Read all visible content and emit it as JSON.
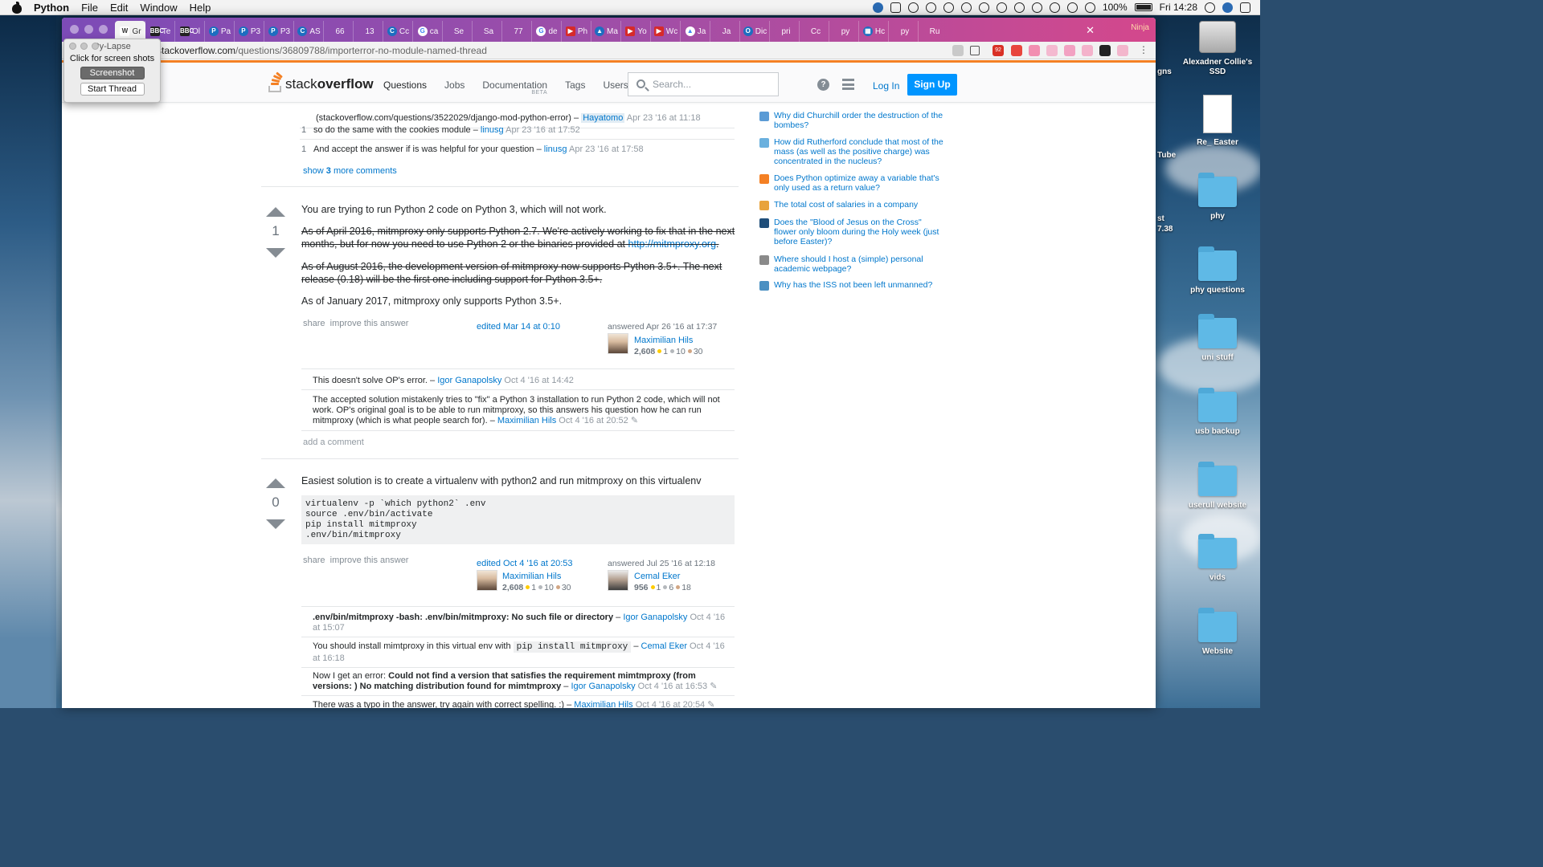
{
  "menubar": {
    "app": "Python",
    "items": [
      "File",
      "Edit",
      "Window",
      "Help"
    ],
    "battery": "100%",
    "clock": "Fri 14:28"
  },
  "desktop": {
    "icons": [
      {
        "label": "Alexadner Collie's SSD",
        "type": "disk"
      },
      {
        "label": "Re_ Easter",
        "type": "doc"
      },
      {
        "label": "phy",
        "type": "folder"
      },
      {
        "label": "phy questions",
        "type": "folder"
      },
      {
        "label": "uni stuff",
        "type": "folder"
      },
      {
        "label": "usb backup",
        "type": "folder"
      },
      {
        "label": "userull website",
        "type": "folder"
      },
      {
        "label": "vids",
        "type": "folder"
      },
      {
        "label": "Website",
        "type": "folder"
      }
    ],
    "fragments": [
      "gns",
      "Tube",
      "st",
      "7.38"
    ]
  },
  "tabs": [
    {
      "fav": "W",
      "label": "Gr",
      "style": ""
    },
    {
      "fav": "BBC",
      "label": "Te",
      "style": "k"
    },
    {
      "fav": "BBC",
      "label": "Ol",
      "style": "k"
    },
    {
      "fav": "P",
      "label": "Pa",
      "style": "b"
    },
    {
      "fav": "P",
      "label": "P3",
      "style": "b"
    },
    {
      "fav": "P",
      "label": "P3",
      "style": "b"
    },
    {
      "fav": "C",
      "label": "AS",
      "style": "b"
    },
    {
      "fav": "",
      "label": "66",
      "style": "none"
    },
    {
      "fav": "",
      "label": "13",
      "style": "none"
    },
    {
      "fav": "C",
      "label": "Cc",
      "style": "b"
    },
    {
      "fav": "G",
      "label": "ca",
      "style": "g"
    },
    {
      "fav": "",
      "label": "Se",
      "style": "none"
    },
    {
      "fav": "",
      "label": "Sa",
      "style": "none"
    },
    {
      "fav": "",
      "label": "77",
      "style": "none"
    },
    {
      "fav": "G",
      "label": "de",
      "style": "g"
    },
    {
      "fav": "▶",
      "label": "Ph",
      "style": "r"
    },
    {
      "fav": "▲",
      "label": "Ma",
      "style": "b"
    },
    {
      "fav": "▶",
      "label": "Yo",
      "style": "r"
    },
    {
      "fav": "▶",
      "label": "Wc",
      "style": "r"
    },
    {
      "fav": "▲",
      "label": "Ja",
      "style": "g"
    },
    {
      "fav": "",
      "label": "Ja",
      "style": "none"
    },
    {
      "fav": "O",
      "label": "Dic",
      "style": "b"
    },
    {
      "fav": "",
      "label": "pri",
      "style": "none"
    },
    {
      "fav": "",
      "label": "Cc",
      "style": "none"
    },
    {
      "fav": "",
      "label": "py",
      "style": "none"
    },
    {
      "fav": "▦",
      "label": "Hc",
      "style": "b"
    },
    {
      "fav": "",
      "label": "py",
      "style": "none"
    },
    {
      "fav": "",
      "label": "Ru",
      "style": "none"
    }
  ],
  "tab_close": "✕",
  "ninja": "Ninja",
  "address": {
    "host": "stackoverflow.com",
    "path": "/questions/36809788/importerror-no-module-named-thread",
    "badge": "92"
  },
  "pylapse": {
    "title": "Py-Lapse",
    "subtitle": "Click for screen shots",
    "screenshot_btn": "Screenshot",
    "thread_btn": "Start Thread"
  },
  "so": {
    "logo_light": "stack",
    "logo_bold": "overflow",
    "nav": [
      "Questions",
      "Jobs",
      "Documentation",
      "Tags",
      "Users"
    ],
    "doc_badge": "BETA",
    "search_placeholder": "Search...",
    "help_glyph": "?",
    "login": "Log In",
    "signup": "Sign Up"
  },
  "top_comments": [
    {
      "score": "",
      "text": "(stackoverflow.com/questions/3522029/django-mod-python-error) –",
      "user": "Hayatomo",
      "date": "Apr 23 '16 at 11:18"
    },
    {
      "score": "1",
      "text": "so do the same with the cookies module –",
      "user": "linusg",
      "date": "Apr 23 '16 at 17:52"
    },
    {
      "score": "1",
      "text": "And accept the answer if is was helpful for your question –",
      "user": "linusg",
      "date": "Apr 23 '16 at 17:58"
    }
  ],
  "show_more": {
    "prefix": "show",
    "count": "3",
    "suffix": "more comments"
  },
  "answer1": {
    "votes": "1",
    "p1": "You are trying to run Python 2 code on Python 3, which will not work.",
    "p2a": "As of April 2016, mitmproxy only supports Python 2.7. We're actively working to fix that in the next months, but for now you need to use Python 2 or the binaries provided at",
    "p2link": "http://mitmproxy.org",
    "p3": "As of August 2016, the development version of mitmproxy now supports Python 3.5+. The next release (0.18) will be the first one including support for Python 3.5+.",
    "p4": "As of January 2017, mitmproxy only supports Python 3.5+.",
    "share": "share",
    "improve": "improve this answer",
    "edited": "edited Mar 14 at 0:10",
    "answered": "answered Apr 26 '16 at 17:37",
    "author": "Maximilian Hils",
    "rep": "2,608",
    "gold": "1",
    "silver": "10",
    "bronze": "30",
    "comments": [
      {
        "text": "This doesn't solve OP's error. –",
        "user": "Igor Ganapolsky",
        "date": "Oct 4 '16 at 14:42"
      },
      {
        "text": "The accepted solution mistakenly tries to \"fix\" a Python 3 installation to run Python 2 code, which will not work. OP's original goal is to be able to run mitmproxy, so this answers his question how he can run mitmproxy (which is what people search for). –",
        "user": "Maximilian Hils",
        "date": "Oct 4 '16 at 20:52"
      }
    ],
    "add_comment": "add a comment"
  },
  "answer2": {
    "votes": "0",
    "p1": "Easiest solution is to create a virtualenv with python2 and run mitmproxy on this virtualenv",
    "code": "virtualenv -p `which python2` .env\nsource .env/bin/activate\npip install mitmproxy\n.env/bin/mitmproxy",
    "share": "share",
    "improve": "improve this answer",
    "edited": "edited Oct 4 '16 at 20:53",
    "editor": "Maximilian Hils",
    "editor_rep": "2,608",
    "editor_gold": "1",
    "editor_silver": "10",
    "editor_bronze": "30",
    "answered": "answered Jul 25 '16 at 12:18",
    "author": "Cemal Eker",
    "rep": "956",
    "gold": "1",
    "silver": "6",
    "bronze": "18",
    "c1_bold": ".env/bin/mitmproxy -bash: .env/bin/mitmproxy: No such file or directory",
    "c1_user": "Igor Ganapolsky",
    "c1_date": "Oct 4 '16 at 15:07",
    "c2_pre": "You should install mimtproxy in this virtual env with",
    "c2_code": "pip install mitmproxy",
    "c2_user": "Cemal Eker",
    "c2_date": "Oct 4 '16 at 16:18",
    "c3_pre": "Now I get an error:",
    "c3_bold": "Could not find a version that satisfies the requirement mimtmproxy (from versions: ) No matching distribution found for mimtmproxy",
    "c3_user": "Igor Ganapolsky",
    "c3_date": "Oct 4 '16 at 16:53",
    "c4_text": "There was a typo in the answer, try again with correct spelling. :) –",
    "c4_user": "Maximilian Hils",
    "c4_date": "Oct 4 '16 at 20:54"
  },
  "hot_questions": [
    {
      "title": "Why did Churchill order the destruction of the bombes?",
      "icon": "history",
      "color": "#5b9bd5"
    },
    {
      "title": "How did Rutherford conclude that most of the mass (as well as the positive charge) was concentrated in the nucleus?",
      "icon": "physics",
      "color": "#6ab0de"
    },
    {
      "title": "Does Python optimize away a variable that's only used as a return value?",
      "icon": "stackoverflow",
      "color": "#f48024"
    },
    {
      "title": "The total cost of salaries in a company",
      "icon": "puzzling",
      "color": "#e8a33b"
    },
    {
      "title": "Does the \"Blood of Jesus on the Cross\" flower only bloom during the Holy week (just before Easter)?",
      "icon": "skeptics",
      "color": "#1f4e79"
    },
    {
      "title": "Where should I host a (simple) personal academic webpage?",
      "icon": "academia",
      "color": "#8a8a8a"
    },
    {
      "title": "Why has the ISS not been left unmanned?",
      "icon": "space",
      "color": "#4a90c2"
    }
  ]
}
